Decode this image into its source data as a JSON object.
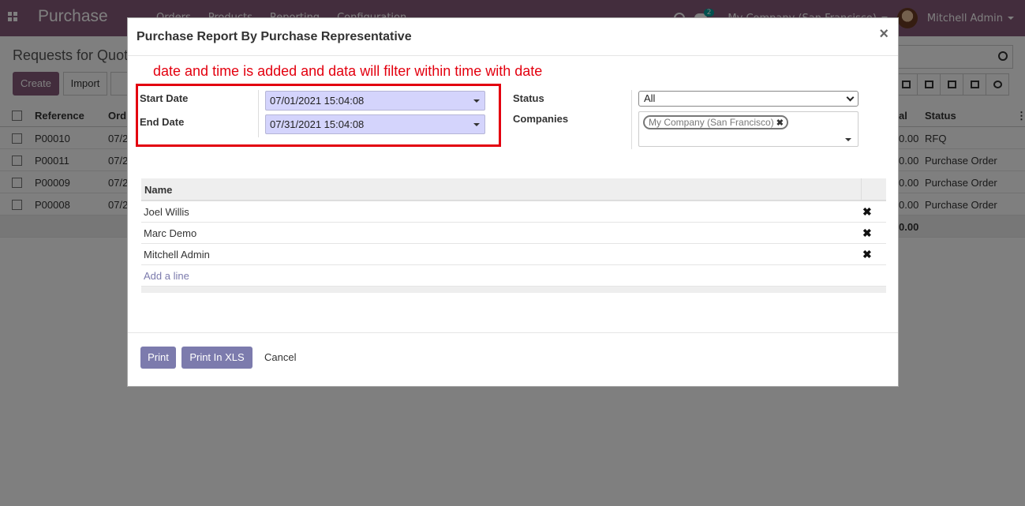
{
  "navbar": {
    "app_title": "Purchase",
    "menu": [
      "Orders",
      "Products",
      "Reporting",
      "Configuration"
    ],
    "chat_badge": "2",
    "company": "My Company (San Francisco)",
    "user": "Mitchell Admin"
  },
  "control_panel": {
    "title": "Requests for Quot",
    "create_label": "Create",
    "import_label": "Import"
  },
  "background_table": {
    "headers": {
      "reference": "Reference",
      "order": "Ord",
      "total": "al",
      "status": "Status"
    },
    "rows": [
      {
        "reference": "P00010",
        "order": "07/2",
        "total": "0.00",
        "status": "RFQ"
      },
      {
        "reference": "P00011",
        "order": "07/2",
        "total": "0.00",
        "status": "Purchase Order"
      },
      {
        "reference": "P00009",
        "order": "07/2",
        "total": "0.00",
        "status": "Purchase Order"
      },
      {
        "reference": "P00008",
        "order": "07/2",
        "total": "0.00",
        "status": "Purchase Order"
      }
    ],
    "footer_total": "0.00"
  },
  "modal": {
    "title": "Purchase Report By Purchase Representative",
    "close_symbol": "×",
    "annotation": "date and time is added and data will filter within time with date",
    "start_date_label": "Start Date",
    "start_date_value": "07/01/2021 15:04:08",
    "end_date_label": "End Date",
    "end_date_value": "07/31/2021 15:04:08",
    "status_label": "Status",
    "status_value": "All",
    "companies_label": "Companies",
    "company_tag": "My Company (San Francisco)",
    "grid_header": "Name",
    "rows": [
      "Joel Willis",
      "Marc Demo",
      "Mitchell Admin"
    ],
    "add_line": "Add a line",
    "print_label": "Print",
    "print_xls_label": "Print In XLS",
    "cancel_label": "Cancel"
  }
}
